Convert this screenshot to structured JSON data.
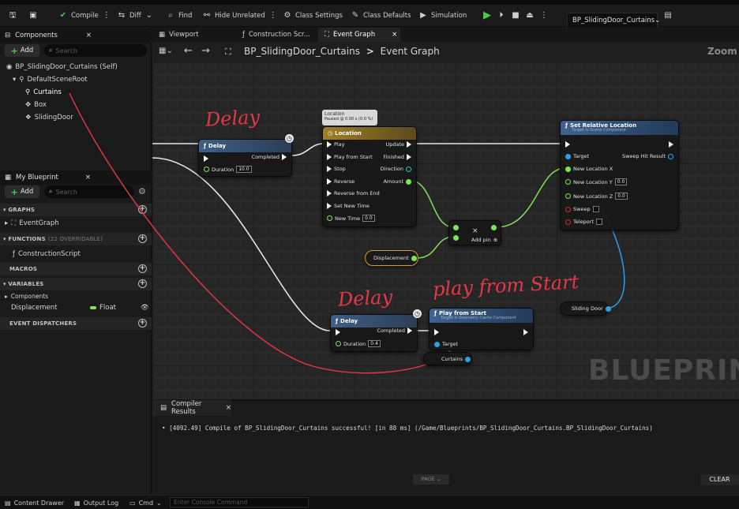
{
  "toolbar": {
    "compile": "Compile",
    "diff": "Diff",
    "find": "Find",
    "hide_unrelated": "Hide Unrelated",
    "class_settings": "Class Settings",
    "class_defaults": "Class Defaults",
    "simulation": "Simulation",
    "blueprint_selector": "BP_SlidingDoor_Curtains"
  },
  "components_panel": {
    "title": "Components",
    "add_label": "Add",
    "search_placeholder": "Search",
    "items": [
      "BP_SlidingDoor_Curtains (Self)",
      "DefaultSceneRoot",
      "Curtains",
      "Box",
      "SlidingDoor"
    ]
  },
  "my_blueprint": {
    "title": "My Blueprint",
    "add_label": "Add",
    "search_placeholder": "Search",
    "graphs_label": "GRAPHS",
    "event_graph": "EventGraph",
    "functions_label": "FUNCTIONS",
    "functions_note": "(22 OVERRIDABLE)",
    "construction_script": "ConstructionScript",
    "macros_label": "MACROS",
    "variables_label": "VARIABLES",
    "components_label": "Components",
    "variable_name": "Displacement",
    "variable_type": "Float",
    "event_dispatchers_label": "EVENT DISPATCHERS"
  },
  "tabs": [
    "Viewport",
    "Construction Scr...",
    "Event Graph"
  ],
  "graph_header": {
    "blueprint": "BP_SlidingDoor_Curtains",
    "separator": ">",
    "graph": "Event Graph",
    "zoom": "Zoom -"
  },
  "nodes": {
    "delay1": {
      "title": "Delay",
      "completed": "Completed",
      "duration_label": "Duration",
      "duration": "10.0"
    },
    "timeline": {
      "tooltip_title": "Location",
      "tooltip_sub": "Paused @ 0.00 s (0.0 %)",
      "title": "Location",
      "inputs": [
        "Play",
        "Play from Start",
        "Stop",
        "Reverse",
        "Reverse from End",
        "Set New Time"
      ],
      "new_time_label": "New Time",
      "new_time": "0.0",
      "outputs": [
        "Update",
        "Finished",
        "Direction",
        "Amount"
      ]
    },
    "set_rel_loc": {
      "title": "Set Relative Location",
      "subtitle": "Target is Scene Component",
      "target": "Target",
      "new_x": "New Location X",
      "new_y": "New Location Y",
      "new_y_val": "0.0",
      "new_z": "New Location Z",
      "new_z_val": "0.0",
      "sweep": "Sweep",
      "teleport": "Teleport",
      "sweep_hit": "Sweep Hit Result"
    },
    "multiply": {
      "symbol": "×",
      "add_pin": "Add pin"
    },
    "displacement": "Displacement",
    "sliding_door": "Sliding Door",
    "delay2": {
      "title": "Delay",
      "completed": "Completed",
      "duration_label": "Duration",
      "duration": "0.4"
    },
    "play_from_start": {
      "title": "Play from Start",
      "subtitle": "Target is Geometry Cache Component",
      "target": "Target"
    },
    "curtains": "Curtains"
  },
  "annotations": {
    "delay_a": "Delay",
    "delay_b": "Delay",
    "play": "play from Start"
  },
  "watermark": "BLUEPRINT",
  "compiler": {
    "tab": "Compiler Results",
    "message": "[4092.49] Compile of BP_SlidingDoor_Curtains successful! [in 88 ms] (/Game/Blueprints/BP_SlidingDoor_Curtains.BP_SlidingDoor_Curtains)",
    "page": "PAGE",
    "clear": "CLEAR"
  },
  "statusbar": {
    "content_drawer": "Content Drawer",
    "output_log": "Output Log",
    "cmd": "Cmd",
    "console_placeholder": "Enter Console Command"
  },
  "colors": {
    "exec_wire": "#e6e6e6",
    "float_wire": "#7ee35a",
    "object_wire": "#2f9ee6",
    "annotation": "#e83747",
    "timeline_header": "#b08a2e",
    "function_header": "#3d5e8a"
  }
}
